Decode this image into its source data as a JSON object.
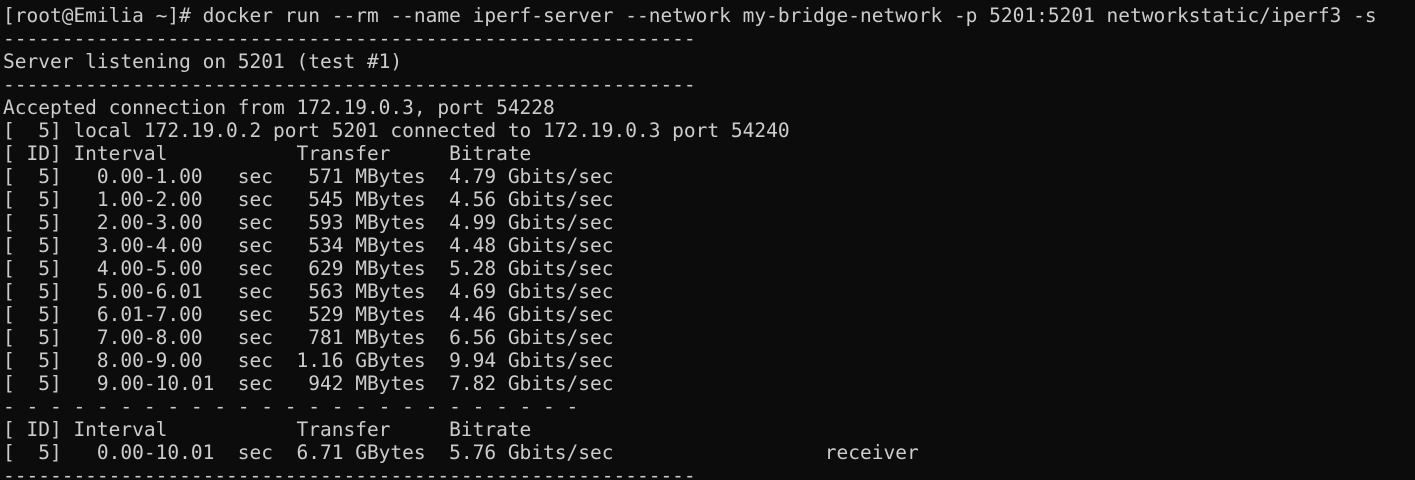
{
  "terminal": {
    "lines": [
      "[root@Emilia ~]# docker run --rm --name iperf-server --network my-bridge-network -p 5201:5201 networkstatic/iperf3 -s",
      "-----------------------------------------------------------",
      "Server listening on 5201 (test #1)",
      "-----------------------------------------------------------",
      "Accepted connection from 172.19.0.3, port 54228",
      "[  5] local 172.19.0.2 port 5201 connected to 172.19.0.3 port 54240",
      "[ ID] Interval           Transfer     Bitrate",
      "[  5]   0.00-1.00   sec   571 MBytes  4.79 Gbits/sec",
      "[  5]   1.00-2.00   sec   545 MBytes  4.56 Gbits/sec",
      "[  5]   2.00-3.00   sec   593 MBytes  4.99 Gbits/sec",
      "[  5]   3.00-4.00   sec   534 MBytes  4.48 Gbits/sec",
      "[  5]   4.00-5.00   sec   629 MBytes  5.28 Gbits/sec",
      "[  5]   5.00-6.01   sec   563 MBytes  4.69 Gbits/sec",
      "[  5]   6.01-7.00   sec   529 MBytes  4.46 Gbits/sec",
      "[  5]   7.00-8.00   sec   781 MBytes  6.56 Gbits/sec",
      "[  5]   8.00-9.00   sec  1.16 GBytes  9.94 Gbits/sec",
      "[  5]   9.00-10.01  sec   942 MBytes  7.82 Gbits/sec",
      "- - - - - - - - - - - - - - - - - - - - - - - - -",
      "[ ID] Interval           Transfer     Bitrate",
      "[  5]   0.00-10.01  sec  6.71 GBytes  5.76 Gbits/sec                  receiver",
      "-----------------------------------------------------------"
    ]
  },
  "colors": {
    "background": "#0c0c0c",
    "foreground": "#cccccc"
  }
}
